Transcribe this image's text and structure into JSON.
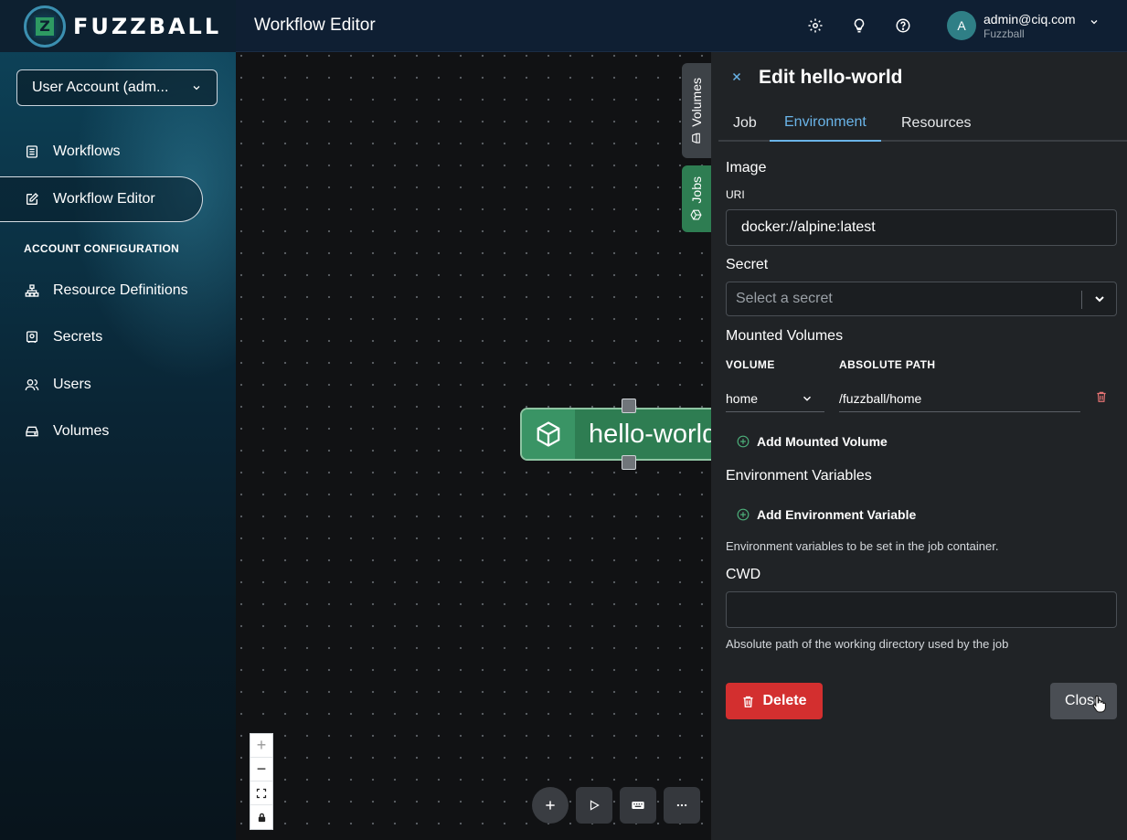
{
  "header": {
    "brand": "FUZZBALL",
    "title": "Workflow Editor",
    "icons": [
      "gear-icon",
      "lightbulb-icon",
      "help-icon"
    ],
    "user": {
      "initial": "A",
      "email": "admin@ciq.com",
      "org": "Fuzzball"
    }
  },
  "sidebar": {
    "account_select": "User Account (adm...",
    "nav": [
      {
        "label": "Workflows",
        "icon": "list-icon"
      },
      {
        "label": "Workflow Editor",
        "icon": "edit-icon",
        "active": true
      }
    ],
    "section_label": "ACCOUNT CONFIGURATION",
    "config": [
      {
        "label": "Resource Definitions",
        "icon": "hierarchy-icon"
      },
      {
        "label": "Secrets",
        "icon": "secret-icon"
      },
      {
        "label": "Users",
        "icon": "users-icon"
      },
      {
        "label": "Volumes",
        "icon": "drive-icon"
      }
    ]
  },
  "canvas": {
    "node_label": "hello-world",
    "side_tabs": {
      "volumes": "Volumes",
      "jobs": "Jobs"
    },
    "zoom": [
      "+",
      "−"
    ]
  },
  "panel": {
    "title": "Edit hello-world",
    "tabs": [
      "Job",
      "Environment",
      "Resources"
    ],
    "active_tab": "Environment",
    "image_heading": "Image",
    "uri_label": "URI",
    "uri_value": "docker://alpine:latest",
    "secret_heading": "Secret",
    "secret_placeholder": "Select a secret",
    "mounted_heading": "Mounted Volumes",
    "col_volume": "VOLUME",
    "col_path": "ABSOLUTE PATH",
    "volume_value": "home",
    "path_value": "/fuzzball/home",
    "add_volume": "Add Mounted Volume",
    "env_heading": "Environment Variables",
    "add_env": "Add Environment Variable",
    "env_help": "Environment variables to be set in the job container.",
    "cwd_heading": "CWD",
    "cwd_value": "",
    "cwd_help": "Absolute path of the working directory used by the job",
    "delete_label": "Delete",
    "close_label": "Close"
  },
  "colors": {
    "accent_tab": "#6ab4e8",
    "node_green": "#2e7d52",
    "jobs_tab": "#2e7d52",
    "delete_red": "#d32f2f"
  }
}
